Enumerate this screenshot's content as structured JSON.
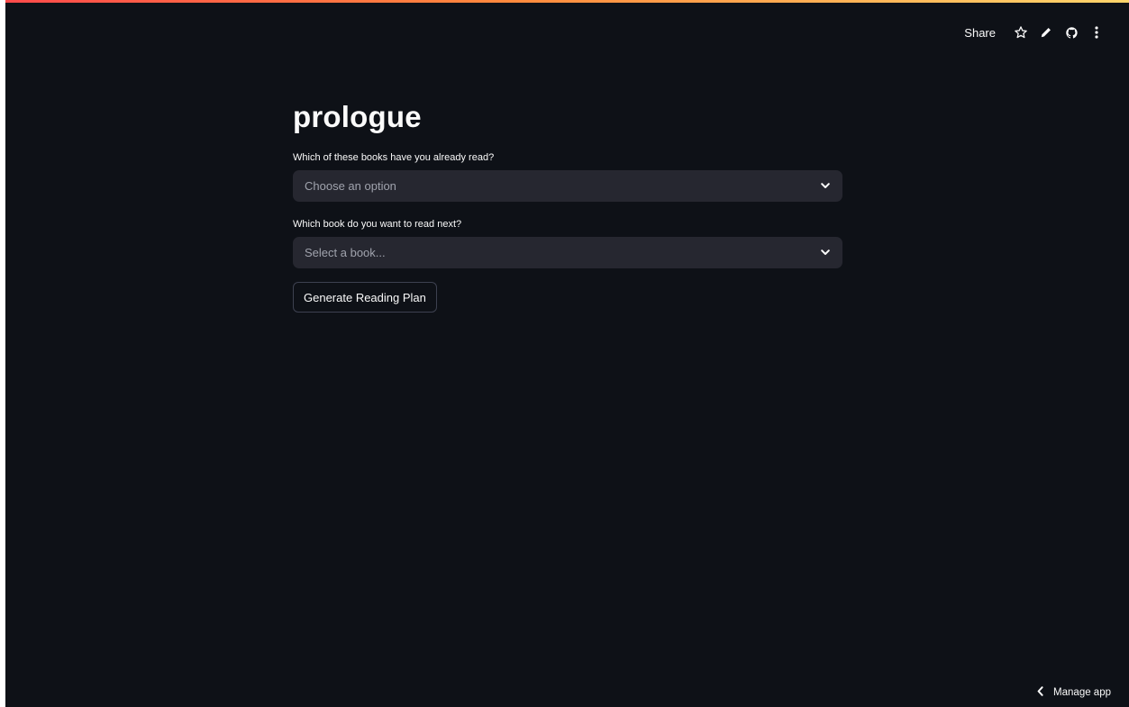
{
  "app": {
    "title": "prologue"
  },
  "toolbar": {
    "share_label": "Share",
    "icons": [
      "star-icon",
      "pencil-icon",
      "github-icon",
      "kebab-menu-icon"
    ]
  },
  "form": {
    "read_books": {
      "label": "Which of these books have you already read?",
      "placeholder": "Choose an option"
    },
    "next_book": {
      "label": "Which book do you want to read next?",
      "placeholder": "Select a book..."
    },
    "submit_label": "Generate Reading Plan"
  },
  "footer": {
    "manage_app_label": "Manage app"
  },
  "colors": {
    "background": "#0e1117",
    "input_background": "#262730",
    "text": "#fafafa",
    "placeholder": "#a0a3ad",
    "button_border": "#3d4150",
    "decoration_start": "#ff4b4b",
    "decoration_end": "#ffd56b"
  }
}
